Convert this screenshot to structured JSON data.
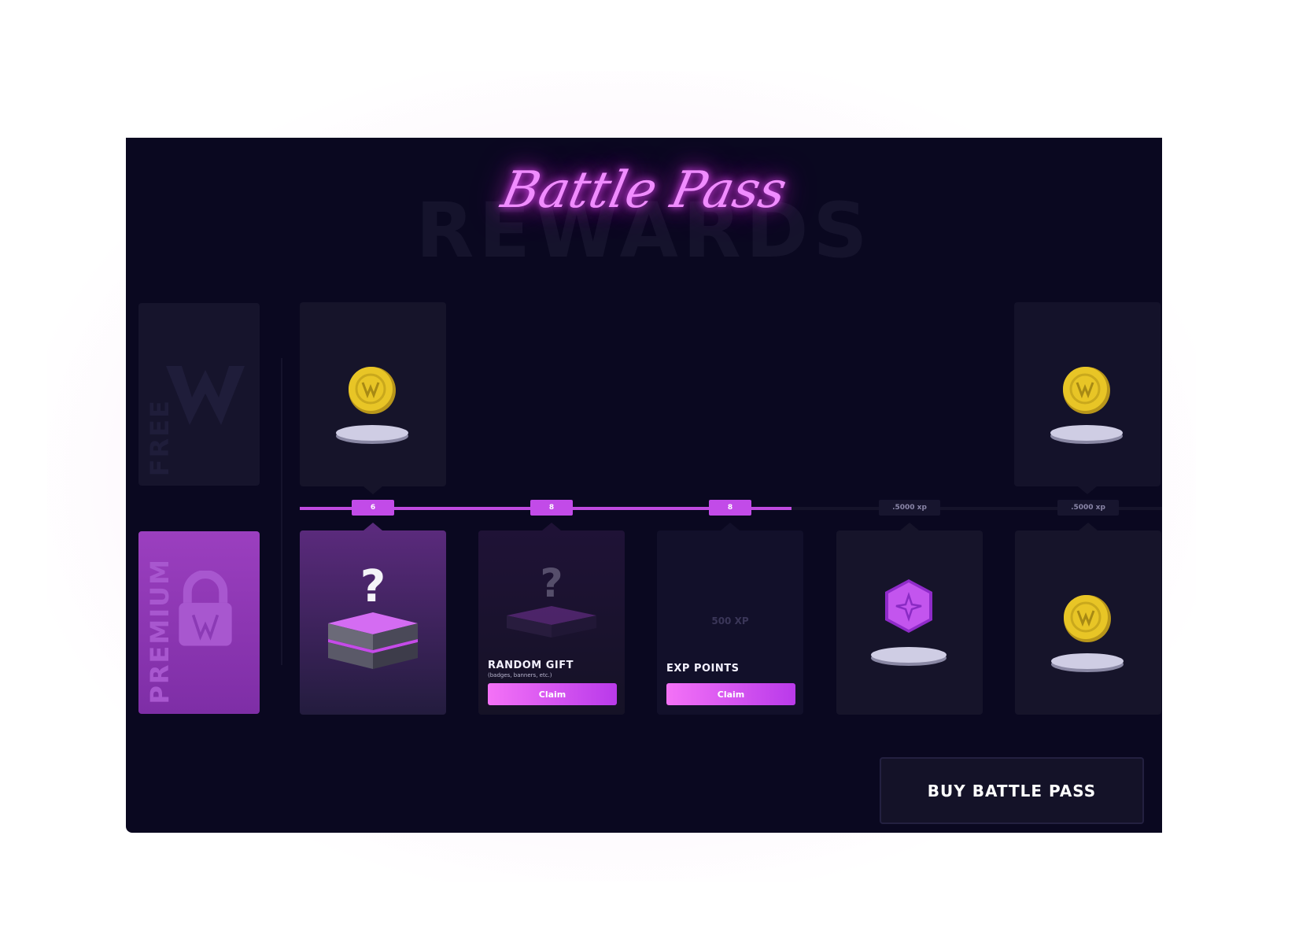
{
  "header": {
    "title": "Battle Pass",
    "background_title": "REWARDS"
  },
  "rows": {
    "free_label": "FREE",
    "premium_label": "PREMIUM"
  },
  "track": {
    "progress_fraction": 0.57,
    "markers": [
      {
        "label": "6",
        "state": "on"
      },
      {
        "label": "8",
        "state": "on"
      },
      {
        "label": "8",
        "state": "on"
      },
      {
        "label": ".5000 xp",
        "state": "off"
      },
      {
        "label": ".5000 xp",
        "state": "off"
      }
    ]
  },
  "free_rewards": [
    {
      "slot": 1,
      "icon": "coin-icon"
    },
    {
      "slot": 5,
      "icon": "coin-icon"
    }
  ],
  "premium_rewards": [
    {
      "slot": 1,
      "icon": "mystery-box-icon"
    },
    {
      "slot": 2,
      "icon": "mystery-box-icon",
      "title": "RANDOM GIFT",
      "subtitle": "(badges, banners, etc.)",
      "claim_label": "Claim"
    },
    {
      "slot": 3,
      "xp_text": "500 XP",
      "title": "EXP POINTS",
      "claim_label": "Claim"
    },
    {
      "slot": 4,
      "icon": "gem-icon"
    },
    {
      "slot": 5,
      "icon": "coin-icon"
    }
  ],
  "actions": {
    "buy_label": "BUY BATTLE PASS"
  },
  "colors": {
    "panel_bg": "#0a0820",
    "accent": "#c24be8",
    "title_glow": "#f08cff",
    "premium": "#9b3fbf",
    "coin": "#e8c526"
  }
}
